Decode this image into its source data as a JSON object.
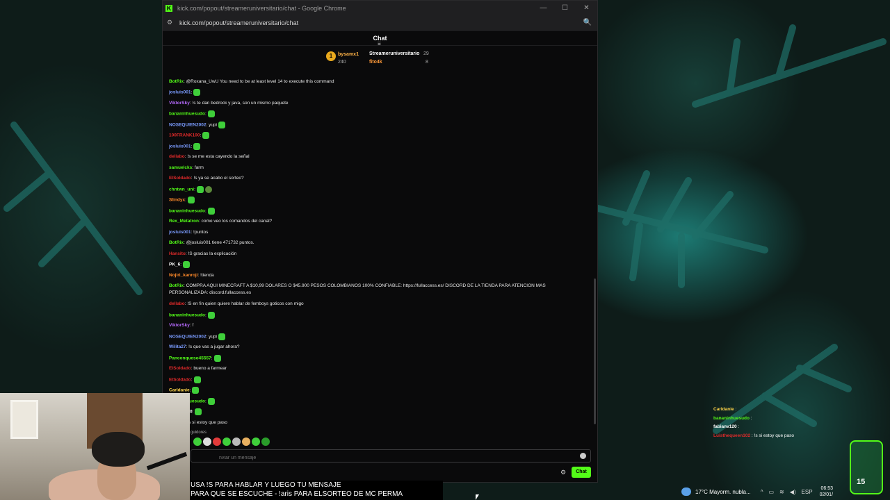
{
  "window": {
    "title": "kick.com/popout/streameruniversitario/chat - Google Chrome",
    "url": "kick.com/popout/streameruniversitario/chat",
    "minimize": "—",
    "maximize": "☐",
    "close": "✕"
  },
  "chat": {
    "header": "Chat",
    "leaderboard": [
      {
        "rank": "1",
        "name": "bysamx1",
        "points": "240"
      },
      {
        "name": "Streameruniversitario",
        "points": "29"
      },
      {
        "name": "fito4k",
        "points": "8"
      }
    ],
    "messages": [
      {
        "user": "BotRix",
        "color": "#53fc18",
        "text": ": @Roxana_UwU You need to be at least level 14 to execute this command",
        "emotes": 0
      },
      {
        "user": "josluis001",
        "color": "#7b9cff",
        "text": ":",
        "emotes": 1
      },
      {
        "user": "ViktorSky",
        "color": "#b86bff",
        "text": ": !s te dan bedrock y java, son un mismo paquete",
        "emotes": 0
      },
      {
        "user": "bananinhuesudo",
        "color": "#53fc18",
        "text": ":",
        "emotes": 1
      },
      {
        "user": "NOSEQUIEN2002",
        "color": "#7b9cff",
        "text": ":  yupi",
        "emotes": 1
      },
      {
        "user": "100FRANK100",
        "color": "#e02a2a",
        "text": ":",
        "emotes": 1
      },
      {
        "user": "josluis001",
        "color": "#7b9cff",
        "text": ":",
        "emotes": 1
      },
      {
        "user": "dellabo",
        "color": "#e02a2a",
        "text": ": !s se me esta cayendo la señal",
        "emotes": 0
      },
      {
        "user": "samuelcks",
        "color": "#53fc18",
        "text": ": farm",
        "emotes": 0
      },
      {
        "user": "ElSoldado",
        "color": "#e02a2a",
        "text": ": !s ya se acabo el sorteo?",
        "emotes": 0
      },
      {
        "user": "chntwn_uni",
        "color": "#53fc18",
        "text": ":",
        "emotes": 2
      },
      {
        "user": "Slindyx",
        "color": "#ff8a2a",
        "text": ":",
        "emotes": 1
      },
      {
        "user": "bananinhuesudo",
        "color": "#53fc18",
        "text": ":",
        "emotes": 1
      },
      {
        "user": "Rex_Metatron",
        "color": "#53fc18",
        "text": ": como veo los comandos del canal?",
        "emotes": 0
      },
      {
        "user": "josluis001",
        "color": "#7b9cff",
        "text": ": !puntos",
        "emotes": 0
      },
      {
        "user": "BotRix",
        "color": "#53fc18",
        "text": ": @josluis001 tiene 471732 puntos.",
        "emotes": 0
      },
      {
        "user": "Hansito",
        "color": "#e02a2a",
        "text": ": !S gracias la explicación",
        "emotes": 0
      },
      {
        "user": "PK_6",
        "color": "#ffffff",
        "text": ":",
        "emotes": 1
      },
      {
        "user": "Nojiri_kanroji",
        "color": "#ff8a2a",
        "text": ": !tienda",
        "emotes": 0
      },
      {
        "user": "BotRix",
        "color": "#53fc18",
        "text": ": COMPRA AQUI MINECRAFT A $10,99 DOLARES O $45.900 PESOS COLOMBIANOS 100% CONFIABLE: https://fullaccess.es/ DISCORD DE LA TIENDA PARA ATENCION MAS",
        "emotes": 0
      },
      {
        "user": "",
        "color": "#ffffff",
        "text": "PERSONALIZADA: discord.fullaccess.es",
        "emotes": 0
      },
      {
        "user": "dellabo",
        "color": "#e02a2a",
        "text": ": !S en fin quien quiere hablar de femboys goticos con migo",
        "emotes": 0
      },
      {
        "user": "bananinhuesudo",
        "color": "#53fc18",
        "text": ":",
        "emotes": 1
      },
      {
        "user": "ViktorSky",
        "color": "#b86bff",
        "text": ": f",
        "emotes": 0
      },
      {
        "user": "NOSEQUIEN2002",
        "color": "#7b9cff",
        "text": ":  yupi",
        "emotes": 1
      },
      {
        "user": "Wilita27",
        "color": "#7b9cff",
        "text": ": !s que vas a jugar ahora?",
        "emotes": 0
      },
      {
        "user": "Panconqueso45557",
        "color": "#53fc18",
        "text": ":",
        "emotes": 1
      },
      {
        "user": "ElSoldado",
        "color": "#e02a2a",
        "text": ": bueno a farmear",
        "emotes": 0
      },
      {
        "user": "ElSoldado",
        "color": "#e02a2a",
        "text": ":",
        "emotes": 1
      },
      {
        "user": "Carldanie",
        "color": "#ffd54a",
        "text": ":",
        "emotes": 1
      },
      {
        "user": "bananinhuesudo",
        "color": "#53fc18",
        "text": ":",
        "emotes": 1
      },
      {
        "user": "fabianv120",
        "color": "#ffffff",
        "text": ":",
        "emotes": 1
      },
      {
        "user": "Luisillo",
        "color": "#e02a2a",
        "text": ": !s si estoy que paso",
        "emotes": 0
      }
    ],
    "followers_label": "guidores",
    "input_placeholder": "nviar un mensaje",
    "send_label": "Chat"
  },
  "subtitle": {
    "line1": "USA !S PARA HABLAR Y LUEGO TU MENSAJE",
    "line2": "PARA QUE SE ESCUCHE - !aris PARA ELSORTEO DE MC PERMA"
  },
  "overlay": [
    {
      "user": "Carldanie",
      "color": "#ffd54a",
      "text": " : "
    },
    {
      "user": "bananinhuesudo",
      "color": "#53fc18",
      "text": " : "
    },
    {
      "user": "fabianv120",
      "color": "#ffffff",
      "text": " : "
    },
    {
      "user": "Luisthequeen102",
      "color": "#e02a2a",
      "text": " : !s si estoy que paso"
    }
  ],
  "goal": {
    "label": "15"
  },
  "taskbar": {
    "weather": "17°C  Mayorm. nubla...",
    "lang": "ESP",
    "time": "06:53",
    "date": "02/01/"
  }
}
